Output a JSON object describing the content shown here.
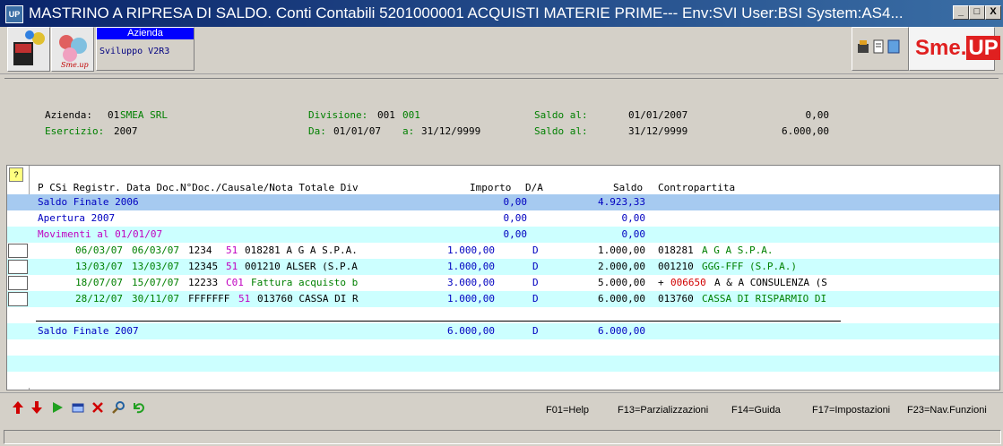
{
  "window": {
    "app_icon": "UP",
    "title": "MASTRINO A RIPRESA DI SALDO.  Conti Contabili 5201000001 ACQUISTI MATERIE PRIME--- Env:SVI User:BSI System:AS4...",
    "minimize": "_",
    "maximize": "□",
    "close": "X"
  },
  "toolbar": {
    "azienda_label": "Azienda",
    "azienda_value": "Sviluppo V2R3",
    "logo_text": "Sme.",
    "logo_up": "UP"
  },
  "header": {
    "azienda_label": "Azienda:",
    "azienda_code": "01",
    "azienda_name": "SMEA SRL",
    "esercizio_label": "Esercizio:",
    "esercizio_value": "2007",
    "divisione_label": "Divisione:",
    "divisione_code": "001",
    "divisione_name": "001",
    "da_label": "Da:",
    "da_value": "01/01/07",
    "a_label": "a:",
    "a_value": "31/12/9999",
    "saldo1_label": "Saldo al:",
    "saldo1_date": "01/01/2007",
    "saldo1_amount": "0,00",
    "saldo2_label": "Saldo al:",
    "saldo2_date": "31/12/9999",
    "saldo2_amount": "6.000,00"
  },
  "grid": {
    "help_button": "?",
    "columns_left": "P CSi Registr. Data Doc.N°Doc./Causale/Nota Totale Div",
    "col_importo": "Importo",
    "col_da": "D/A",
    "col_saldo": "Saldo",
    "col_contropartita": "Contropartita",
    "saldo_finale_2006": {
      "desc": "Saldo Finale 2006",
      "importo": "0,00",
      "saldo": "4.923,33"
    },
    "apertura": {
      "desc": "Apertura 2007",
      "importo": "0,00",
      "saldo": "0,00"
    },
    "movimenti": {
      "desc": "Movimenti al 01/01/07",
      "importo": "0,00",
      "saldo": "0,00"
    },
    "rows": [
      {
        "reg": "06/03/07",
        "data_doc": "06/03/07",
        "ndoc": "1234",
        "caus": "51",
        "nota": "018281 A G A S.P.A.",
        "totale": "1.000,00",
        "da": "D",
        "saldo": "1.000,00",
        "cp_pre": "",
        "cp_code": "018281",
        "cp_name": "A G A S.P.A."
      },
      {
        "reg": "13/03/07",
        "data_doc": "13/03/07",
        "ndoc": "12345",
        "caus": "51",
        "nota": "001210 ALSER (S.P.A",
        "totale": "1.000,00",
        "da": "D",
        "saldo": "2.000,00",
        "cp_pre": "",
        "cp_code": "001210",
        "cp_name": "GGG-FFF (S.P.A.)"
      },
      {
        "reg": "18/07/07",
        "data_doc": "15/07/07",
        "ndoc": "12233",
        "caus": "C01",
        "nota": "Fattura acquisto b",
        "totale": "3.000,00",
        "da": "D",
        "saldo": "5.000,00",
        "cp_pre": "+",
        "cp_code": "006650",
        "cp_name": "A & A CONSULENZA (S"
      },
      {
        "reg": "28/12/07",
        "data_doc": "30/11/07",
        "ndoc": "FFFFFFF",
        "caus": "51",
        "nota": "013760 CASSA DI R",
        "totale": "1.000,00",
        "da": "D",
        "saldo": "6.000,00",
        "cp_pre": "",
        "cp_code": "013760",
        "cp_name": "CASSA DI RISPARMIO DI"
      }
    ],
    "saldo_finale_2007": {
      "desc": "Saldo Finale 2007",
      "totale": "6.000,00",
      "da": "D",
      "saldo": "6.000,00"
    }
  },
  "bottom": {
    "f01": "F01=Help",
    "f13": "F13=Parzializzazioni",
    "f14": "F14=Guida",
    "f17": "F17=Impostazioni",
    "f23": "F23=Nav.Funzioni"
  },
  "icons": [
    "arrow-up-icon",
    "arrow-down-icon",
    "play-icon",
    "window-icon",
    "delete-icon",
    "search-icon",
    "refresh-icon"
  ]
}
